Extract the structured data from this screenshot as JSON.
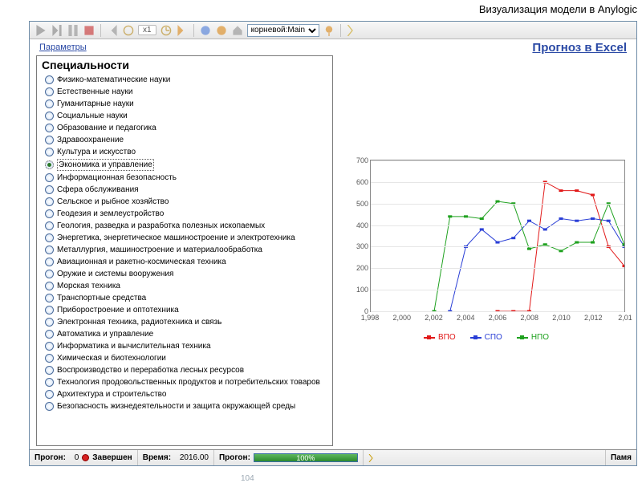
{
  "outside_title": "Визуализация модели в Anylogic",
  "toolbar": {
    "speed_label": "x1",
    "combo_value": "корневой:Main"
  },
  "links": {
    "left": "Параметры",
    "right": "Прогноз в Excel"
  },
  "panel_title": "Специальности",
  "specialties": [
    "Физико-математические науки",
    "Естественные науки",
    "Гуманитарные науки",
    "Социальные науки",
    "Образование и педагогика",
    "Здравоохранение",
    "Культура и искусство",
    "Экономика и управление",
    "Информационная безопасность",
    "Сфера обслуживания",
    "Сельское и рыбное хозяйство",
    "Геодезия и землеустройство",
    "Геология, разведка и разработка полезных ископаемых",
    "Энергетика, энергетическое машиностроение и электротехника",
    "Металлургия, машиностроение и материалообработка",
    "Авиационная и ракетно-космическая техника",
    "Оружие и системы вооружения",
    "Морская техника",
    "Транспортные средства",
    "Приборостроение и оптотехника",
    "Электронная техника, радиотехника и связь",
    "Автоматика и управление",
    "Информатика и вычислительная техника",
    "Химическая и биотехнологии",
    "Воспроизводство и переработка лесных ресурсов",
    "Технология продовольственных продуктов и потребительских товаров",
    "Архитектура и строительство",
    "Безопасность жизнедеятельности и защита окружающей среды"
  ],
  "selected_index": 7,
  "chart_data": {
    "type": "line",
    "xlabel": "",
    "ylabel": "",
    "x": [
      1998,
      1999,
      2000,
      2001,
      2002,
      2003,
      2004,
      2005,
      2006,
      2007,
      2008,
      2009,
      2010,
      2011,
      2012,
      2013,
      2014
    ],
    "xlim": [
      1998,
      2014
    ],
    "ylim": [
      0,
      700
    ],
    "y_ticks": [
      0,
      100,
      200,
      300,
      400,
      500,
      600,
      700
    ],
    "x_ticks": [
      1998,
      2000,
      2002,
      2004,
      2006,
      2008,
      2010,
      2012,
      2014
    ],
    "x_tick_labels": [
      "1,998",
      "2,000",
      "2,002",
      "2,004",
      "2,006",
      "2,008",
      "2,010",
      "2,012",
      "2,01"
    ],
    "series": [
      {
        "name": "ВПО",
        "color": "#e11919",
        "values": [
          null,
          null,
          null,
          null,
          null,
          null,
          null,
          null,
          0,
          0,
          0,
          600,
          560,
          560,
          540,
          300,
          210
        ]
      },
      {
        "name": "СПО",
        "color": "#2a3fd6",
        "values": [
          null,
          null,
          null,
          null,
          null,
          0,
          300,
          380,
          320,
          340,
          420,
          380,
          430,
          420,
          430,
          420,
          300
        ]
      },
      {
        "name": "НПО",
        "color": "#1fa11f",
        "values": [
          null,
          null,
          null,
          null,
          0,
          440,
          440,
          430,
          510,
          500,
          290,
          310,
          280,
          320,
          320,
          500,
          310
        ]
      }
    ]
  },
  "legend": {
    "items": [
      "ВПО",
      "СПО",
      "НПО"
    ]
  },
  "status": {
    "run_label": "Прогон:",
    "run_value": "0",
    "state": "Завершен",
    "time_label": "Время:",
    "time_value": "2016.00",
    "progress_label": "Прогон:",
    "progress_pct": "100%",
    "memory_label": "Памя"
  },
  "page_number": "104"
}
